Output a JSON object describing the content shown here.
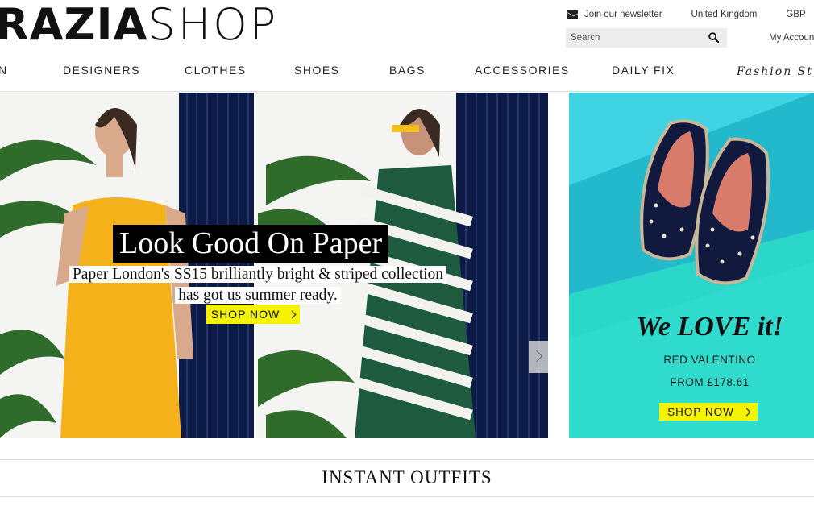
{
  "brand": {
    "logo_bold": "RAZIA",
    "logo_thin": "SHOP"
  },
  "utility": {
    "newsletter": "Join our newsletter",
    "country": "United Kingdom",
    "currency": "GBP",
    "account": "My Account",
    "search_placeholder": "Search"
  },
  "nav": {
    "items": [
      "N",
      "DESIGNERS",
      "CLOTHES",
      "SHOES",
      "BAGS",
      "ACCESSORIES",
      "DAILY FIX",
      "Fashion Sty"
    ]
  },
  "hero": {
    "title": "Look Good On Paper",
    "subtitle_line1": "Paper London's SS15 brilliantly bright & striped collection",
    "subtitle_line2": "has got us summer ready.",
    "cta": "SHOP NOW"
  },
  "promo": {
    "title": "We LOVE it!",
    "brand": "RED VALENTINO",
    "price": "FROM £178.61",
    "cta": "SHOP NOW"
  },
  "section": {
    "title": "INSTANT OUTFITS"
  },
  "colors": {
    "accent_yellow": "#f5f300",
    "promo_teal": "#2fc9d8",
    "stripe_navy": "#0d1a45"
  }
}
